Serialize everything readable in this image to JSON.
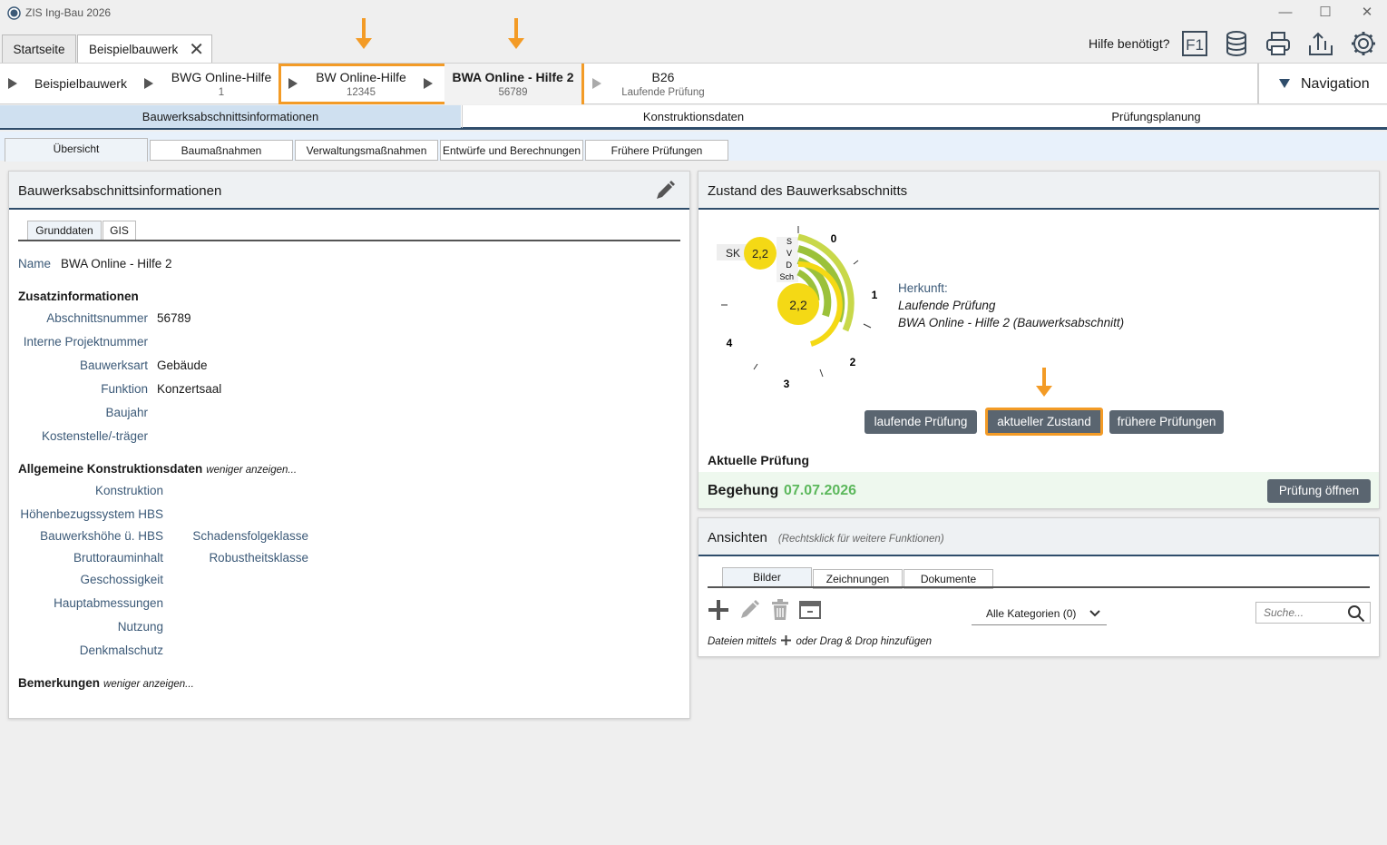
{
  "window": {
    "title": "ZIS Ing-Bau 2026",
    "minimize": "—",
    "maximize": "☐",
    "close": "✕"
  },
  "doc_tabs": {
    "home": "Startseite",
    "active": "Beispielbauwerk",
    "close": "✕"
  },
  "toolbar": {
    "help_label": "Hilfe benötigt?",
    "f1": "F1"
  },
  "breadcrumb": [
    {
      "line1": "Beispielbauwerk",
      "line2": ""
    },
    {
      "line1": "BWG Online-Hilfe",
      "line2": "1"
    },
    {
      "line1": "BW Online-Hilfe",
      "line2": "12345"
    },
    {
      "line1": "BWA Online - Hilfe 2",
      "line2": "56789"
    },
    {
      "line1": "B26",
      "line2": "Laufende Prüfung"
    }
  ],
  "navigation_label": "Navigation",
  "main_tabs": [
    "Bauwerksabschnittsinformationen",
    "Konstruktionsdaten",
    "Prüfungsplanung"
  ],
  "sub_tabs": [
    "Übersicht",
    "Baumaßnahmen",
    "Verwaltungsmaßnahmen",
    "Entwürfe und Berechnungen",
    "Frühere Prüfungen"
  ],
  "left": {
    "title": "Bauwerksabschnittsinformationen",
    "tabs": [
      "Grunddaten",
      "GIS"
    ],
    "name_label": "Name",
    "name_value": "BWA Online - Hilfe 2",
    "zusatz": "Zusatzinformationen",
    "abschnitt_label": "Abschnittsnummer",
    "abschnitt_value": "56789",
    "projekt_label": "Interne Projektnummer",
    "art_label": "Bauwerksart",
    "art_value": "Gebäude",
    "funktion_label": "Funktion",
    "funktion_value": "Konzertsaal",
    "baujahr_label": "Baujahr",
    "kosten_label": "Kostenstelle/-träger",
    "allg": "Allgemeine Konstruktionsdaten",
    "weniger": "weniger anzeigen...",
    "konstruktion": "Konstruktion",
    "hoehen": "Höhenbezugssystem HBS",
    "bauhoehe": "Bauwerkshöhe ü. HBS",
    "schaden": "Schadensfolgeklasse",
    "brutto": "Bruttorauminhalt",
    "robust": "Robustheitsklasse",
    "geschoss": "Geschossigkeit",
    "haupt": "Hauptabmessungen",
    "nutzung": "Nutzung",
    "denkmal": "Denkmalschutz",
    "bemerkungen": "Bemerkungen",
    "weniger2": "weniger anzeigen..."
  },
  "zustand": {
    "title": "Zustand des Bauwerksabschnitts",
    "sk_label": "SK",
    "sk_value": "2,2",
    "center_value": "2,2",
    "gauge_labels": {
      "s": "S",
      "v": "V",
      "d": "D",
      "sch": "Sch",
      "n0": "0",
      "n1": "1",
      "n2": "2",
      "n3": "3",
      "n4": "4"
    },
    "herkunft_label": "Herkunft:",
    "herkunft_1": "Laufende Prüfung",
    "herkunft_2": "BWA Online - Hilfe 2 (Bauwerksabschnitt)",
    "btn_laufend": "laufende Prüfung",
    "btn_aktuell": "aktueller Zustand",
    "btn_frueher": "frühere Prüfungen",
    "aktuelle_label": "Aktuelle Prüfung",
    "begehung": "Begehung",
    "begehung_date": "07.07.2026",
    "btn_oeffnen": "Prüfung öffnen",
    "colors": {
      "yellow": "#f4d915",
      "green": "#9bc13a",
      "lime": "#c8d84a",
      "date": "#5cb85c"
    }
  },
  "ansichten": {
    "title": "Ansichten",
    "hint": "(Rechtsklick für weitere Funktionen)",
    "tabs": [
      "Bilder",
      "Zeichnungen",
      "Dokumente"
    ],
    "kategorie": "Alle Kategorien (0)",
    "search_placeholder": "Suche...",
    "drop_hint_1": "Dateien mittels",
    "drop_hint_2": "oder Drag & Drop hinzufügen"
  }
}
